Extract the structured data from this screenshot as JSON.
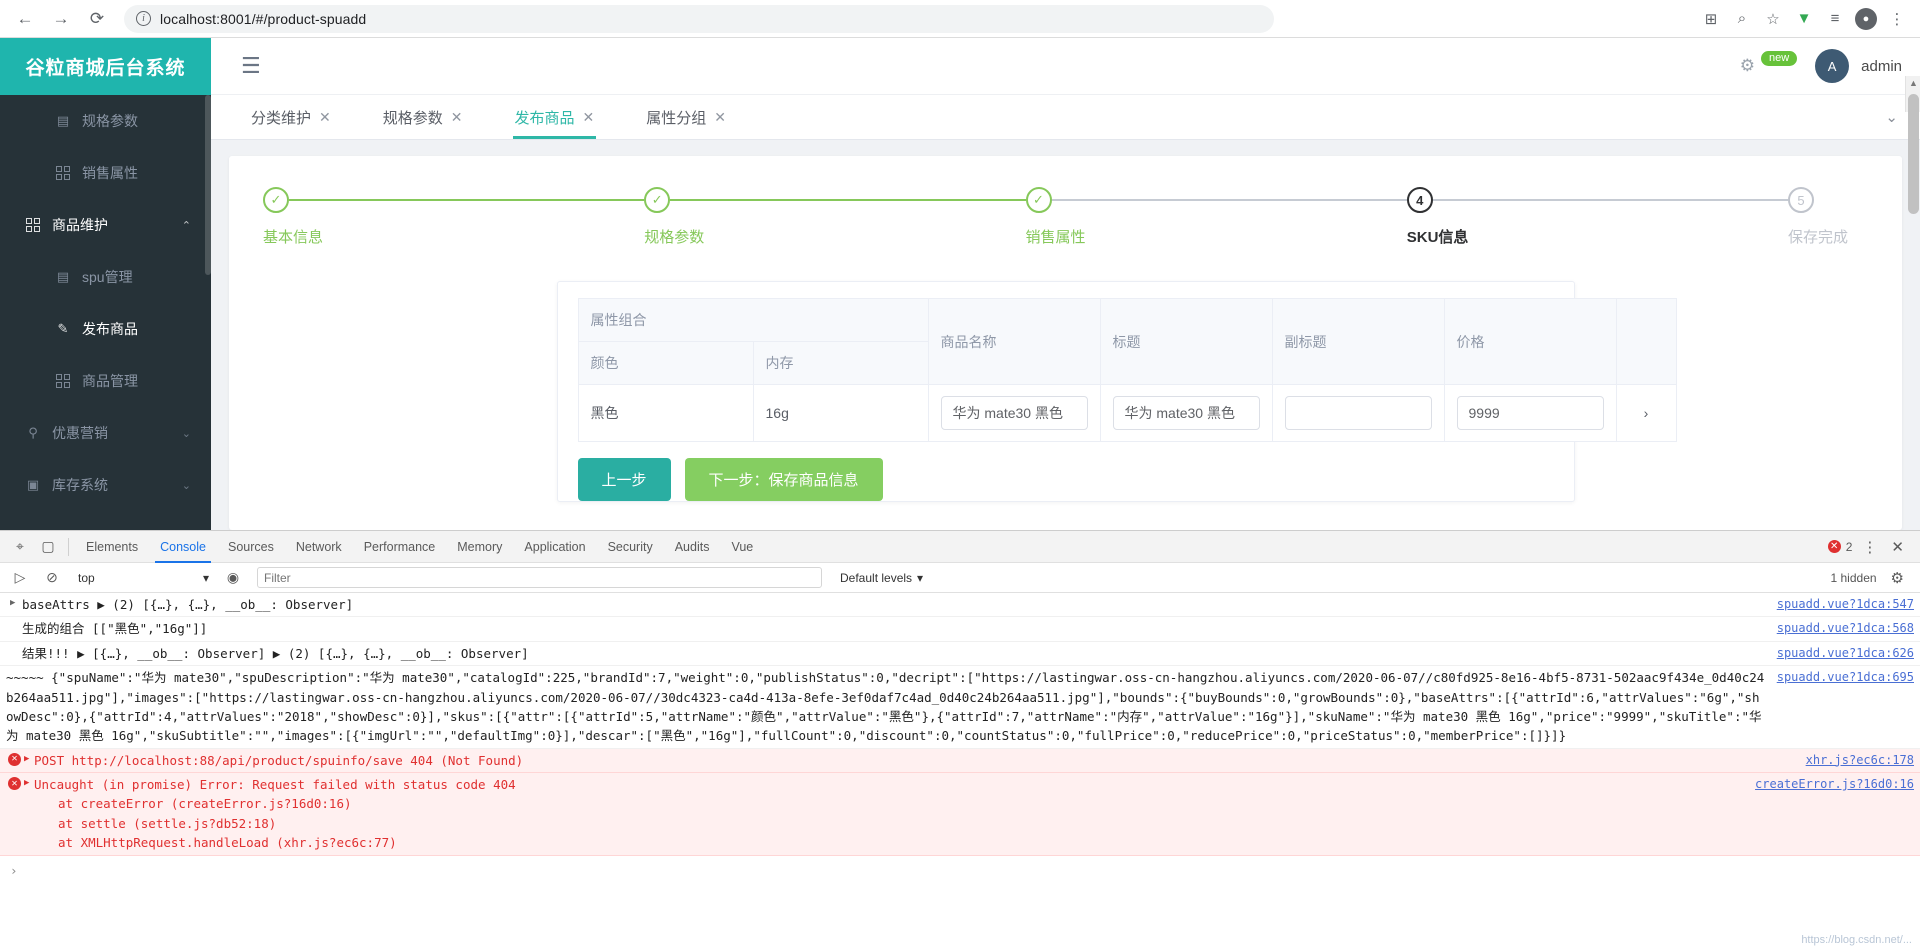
{
  "browser": {
    "back_icon": "←",
    "forward_icon": "→",
    "reload_icon": "⟳",
    "info_icon": "i",
    "url": "localhost:8001/#/product-spuadd",
    "right_icons": [
      "extensions-icon",
      "search-icon",
      "bookmark-star-icon",
      "download-icon",
      "list-icon",
      "profile-icon",
      "menu-icon"
    ]
  },
  "sidebar": {
    "logo": "谷粒商城后台系统",
    "items": [
      {
        "label": "规格参数",
        "icon": "document-icon",
        "level": "sub",
        "active": false
      },
      {
        "label": "销售属性",
        "icon": "grid-icon",
        "level": "sub",
        "active": false
      },
      {
        "label": "商品维护",
        "icon": "grid-icon",
        "level": "group",
        "active": true,
        "chevron": "⌃"
      },
      {
        "label": "spu管理",
        "icon": "document-gear-icon",
        "level": "sub",
        "active": false
      },
      {
        "label": "发布商品",
        "icon": "edit-icon",
        "level": "sub",
        "active": true
      },
      {
        "label": "商品管理",
        "icon": "grid-icon",
        "level": "sub",
        "active": false
      },
      {
        "label": "优惠营销",
        "icon": "tag-icon",
        "level": "group",
        "active": false,
        "chevron": "⌄"
      },
      {
        "label": "库存系统",
        "icon": "box-icon",
        "level": "group",
        "active": false,
        "chevron": "⌄"
      }
    ]
  },
  "topbar": {
    "hamburger_icon": "☰",
    "gear_icon": "⚙",
    "new_badge": "new",
    "username": "admin",
    "avatar_initial": "A"
  },
  "tabs": {
    "items": [
      {
        "label": "分类维护",
        "close": "✕",
        "active": false
      },
      {
        "label": "规格参数",
        "close": "✕",
        "active": false
      },
      {
        "label": "发布商品",
        "close": "✕",
        "active": true
      },
      {
        "label": "属性分组",
        "close": "✕",
        "active": false
      }
    ],
    "chevron_icon": "⌄"
  },
  "steps": [
    {
      "label": "基本信息",
      "state": "done",
      "marker": "✓"
    },
    {
      "label": "规格参数",
      "state": "done",
      "marker": "✓"
    },
    {
      "label": "销售属性",
      "state": "done",
      "marker": "✓"
    },
    {
      "label": "SKU信息",
      "state": "current",
      "marker": "4"
    },
    {
      "label": "保存完成",
      "state": "pending",
      "marker": "5"
    }
  ],
  "sku_table": {
    "group_header": "属性组合",
    "columns": [
      "颜色",
      "内存",
      "商品名称",
      "标题",
      "副标题",
      "价格",
      ""
    ],
    "rows": [
      {
        "color": "黑色",
        "memory": "16g",
        "product_name": "华为 mate30 黑色",
        "title": "华为 mate30 黑色",
        "subtitle": "",
        "price": "9999",
        "expand_icon": "›"
      }
    ],
    "subtitle_placeholder": ""
  },
  "actions": {
    "prev": "上一步",
    "next": "下一步：保存商品信息"
  },
  "devtools": {
    "inspect_icon": "⌖",
    "device_icon": "▢",
    "tabs": [
      "Elements",
      "Console",
      "Sources",
      "Network",
      "Performance",
      "Memory",
      "Application",
      "Security",
      "Audits",
      "Vue"
    ],
    "active_tab": "Console",
    "error_count": "2",
    "more_icon": "⋮",
    "close_icon": "✕",
    "toolbar": {
      "execute_icon": "▷",
      "clear_icon": "⊘",
      "context": "top",
      "eye_icon": "◉",
      "filter_placeholder": "Filter",
      "levels": "Default levels",
      "hidden": "1 hidden",
      "settings_icon": "⚙"
    },
    "messages": [
      {
        "type": "log",
        "expandable": true,
        "text": "baseAttrs ▶ (2) [{…}, {…}, __ob__: Observer]",
        "source": "spuadd.vue?1dca:547"
      },
      {
        "type": "log",
        "expandable": false,
        "text": "生成的组合 [[\"黑色\",\"16g\"]]",
        "source": "spuadd.vue?1dca:568"
      },
      {
        "type": "log",
        "expandable": true,
        "text": "结果!!! ▶ [{…}, __ob__: Observer] ▶ (2) [{…}, {…}, __ob__: Observer]",
        "source": "spuadd.vue?1dca:626"
      },
      {
        "type": "log",
        "expandable": false,
        "text": "~~~~~ {\"spuName\":\"华为 mate30\",\"spuDescription\":\"华为 mate30\",\"catalogId\":225,\"brandId\":7,\"weight\":0,\"publishStatus\":0,\"decript\":[\"https://lastingwar.oss-cn-hangzhou.aliyuncs.com/2020-06-07//c80fd925-8e16-4bf5-8731-502aac9f434e_0d40c24b264aa511.jpg\"],\"images\":[\"https://lastingwar.oss-cn-hangzhou.aliyuncs.com/2020-06-07//30dc4323-ca4d-413a-8efe-3ef0daf7c4ad_0d40c24b264aa511.jpg\"],\"bounds\":{\"buyBounds\":0,\"growBounds\":0},\"baseAttrs\":[{\"attrId\":6,\"attrValues\":\"6g\",\"showDesc\":0},{\"attrId\":4,\"attrValues\":\"2018\",\"showDesc\":0}],\"skus\":[{\"attr\":[{\"attrId\":5,\"attrName\":\"颜色\",\"attrValue\":\"黑色\"},{\"attrId\":7,\"attrName\":\"内存\",\"attrValue\":\"16g\"}],\"skuName\":\"华为 mate30 黑色 16g\",\"price\":\"9999\",\"skuTitle\":\"华为 mate30 黑色 16g\",\"skuSubtitle\":\"\",\"images\":[{\"imgUrl\":\"\",\"defaultImg\":0}],\"descar\":[\"黑色\",\"16g\"],\"fullCount\":0,\"discount\":0,\"countStatus\":0,\"fullPrice\":0,\"reducePrice\":0,\"priceStatus\":0,\"memberPrice\":[]}]}",
        "source": "spuadd.vue?1dca:695"
      },
      {
        "type": "error",
        "expandable": true,
        "text": "POST http://localhost:88/api/product/spuinfo/save 404 (Not Found)",
        "link": "http://localhost:88/api/product/spuinfo/save",
        "source": "xhr.js?ec6c:178"
      },
      {
        "type": "error",
        "expandable": true,
        "text": "Uncaught (in promise) Error: Request failed with status code 404",
        "stack": [
          "at createError (createError.js?16d0:16)",
          "at settle (settle.js?db52:18)",
          "at XMLHttpRequest.handleLoad (xhr.js?ec6c:77)"
        ],
        "source": "createError.js?16d0:16"
      }
    ],
    "prompt_caret": "›",
    "watermark": "https://blog.csdn.net/..."
  }
}
